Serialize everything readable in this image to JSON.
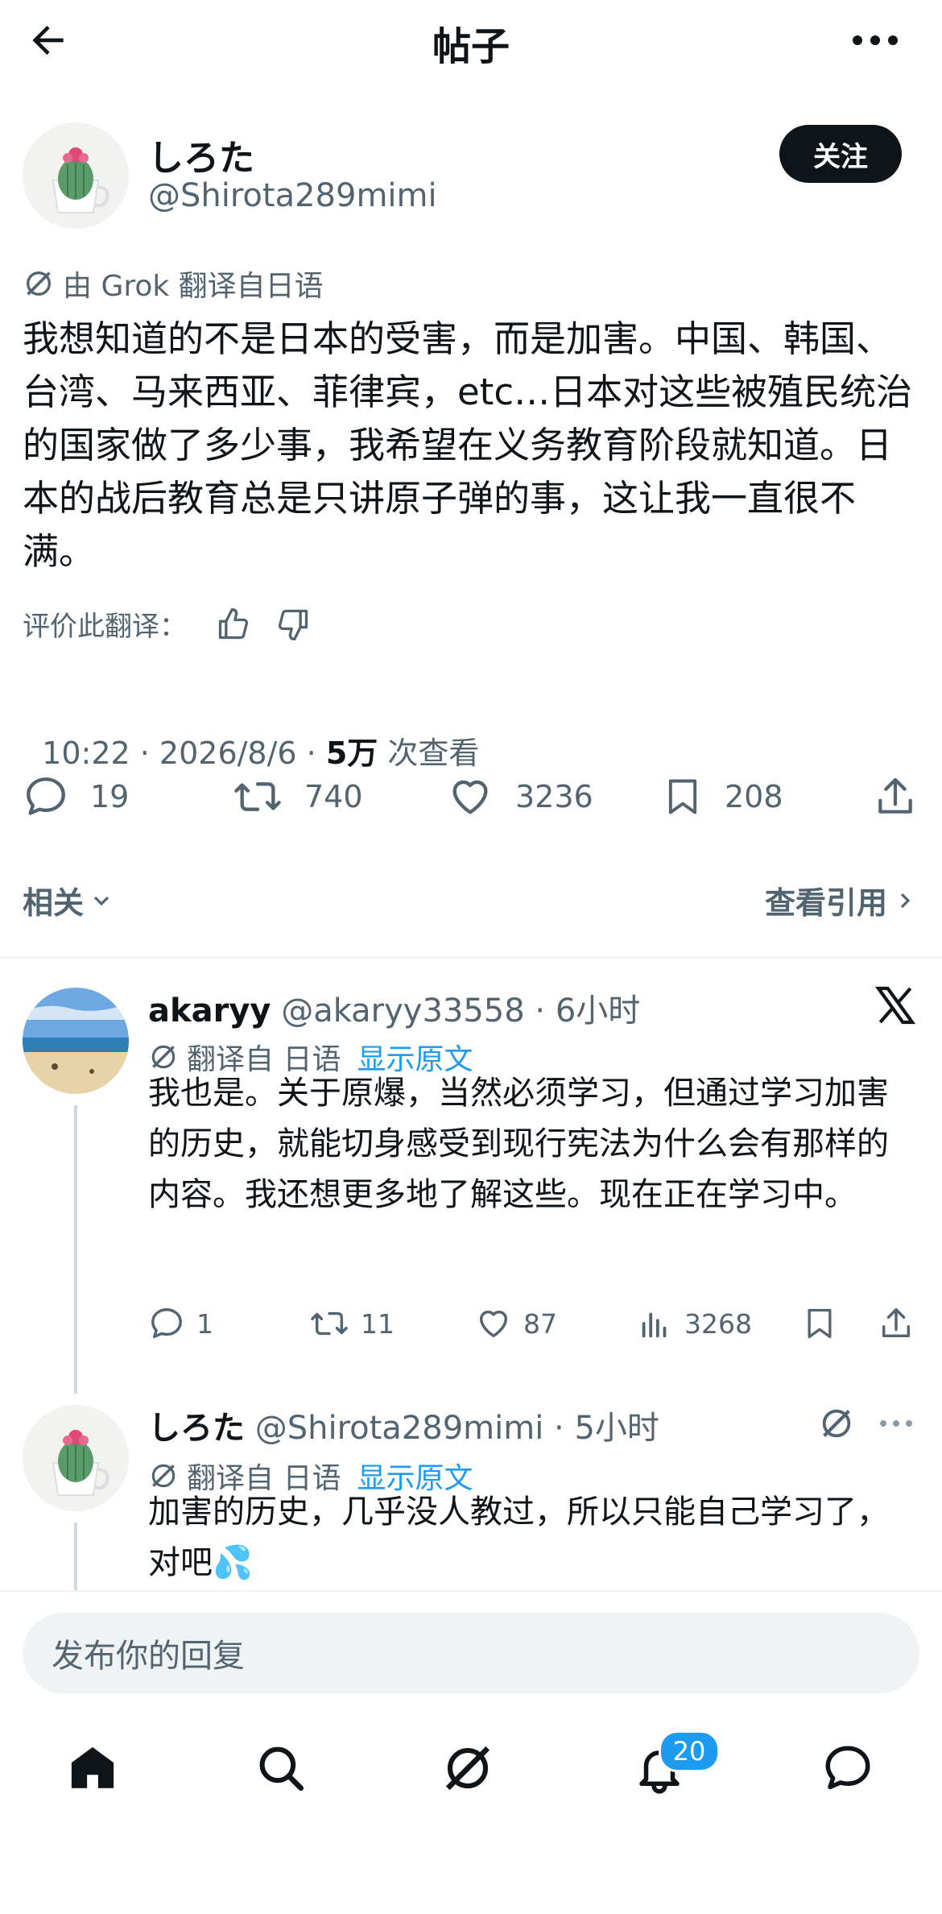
{
  "header": {
    "title": "帖子"
  },
  "post": {
    "author_name": "しろた",
    "author_handle": "@Shirota289mimi",
    "follow_label": "关注",
    "translated_note": "由 Grok 翻译自日语",
    "text": "我想知道的不是日本的受害，而是加害。中国、韩国、台湾、马来西亚、菲律宾，etc…日本对这些被殖民统治的国家做了多少事，我希望在义务教育阶段就知道。日本的战后教育总是只讲原子弹的事，这让我一直很不满。",
    "rate_label": "评价此翻译：",
    "timestamp": "10:22 · 2026/8/6 · ",
    "views": "5万",
    "views_suffix": " 次查看",
    "replies": "19",
    "retweets": "740",
    "likes": "3236",
    "bookmarks": "208"
  },
  "bar": {
    "related": "相关",
    "quotes": "查看引用"
  },
  "replies": [
    {
      "name": "akaryy",
      "handle": "@akaryy33558 · 6小时",
      "translate_label": "翻译自 日语",
      "show_original": "显示原文",
      "text": "我也是。关于原爆，当然必须学习，但通过学习加害的历史，就能切身感受到现行宪法为什么会有那样的内容。我还想更多地了解这些。现在正在学习中。",
      "replies": "1",
      "retweets": "11",
      "likes": "87",
      "views": "3268"
    },
    {
      "name": "しろた",
      "handle": "@Shirota289mimi · 5小时",
      "translate_label": "翻译自 日语",
      "show_original": "显示原文",
      "text": "加害的历史，几乎没人教过，所以只能自己学习了，对吧💦"
    }
  ],
  "composer": {
    "placeholder": "发布你的回复"
  },
  "tabbar": {
    "notifications_badge": "20"
  }
}
